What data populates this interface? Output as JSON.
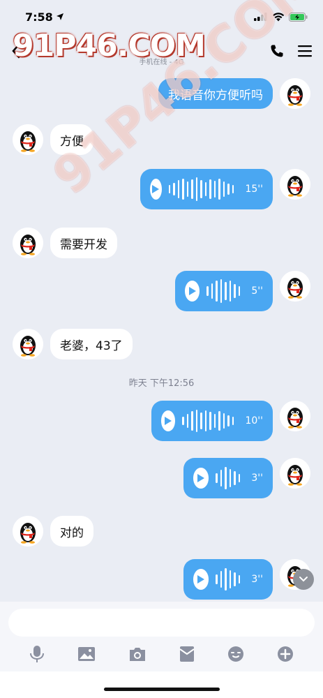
{
  "status_bar": {
    "time": "7:58"
  },
  "header": {
    "subtitle": "手机在线 - 4G"
  },
  "watermark": {
    "text": "91P46.COM"
  },
  "messages": [
    {
      "side": "out",
      "type": "text",
      "text": "我语音你方便听吗"
    },
    {
      "side": "in",
      "type": "text",
      "text": "方便"
    },
    {
      "side": "out",
      "type": "voice",
      "duration": "15''"
    },
    {
      "side": "in",
      "type": "text",
      "text": "需要开发"
    },
    {
      "side": "out",
      "type": "voice",
      "duration": "5''"
    },
    {
      "side": "in",
      "type": "text",
      "text": "老婆，43了"
    },
    {
      "side": "out",
      "type": "voice",
      "duration": "10''"
    },
    {
      "side": "out",
      "type": "voice",
      "duration": "3''"
    },
    {
      "side": "in",
      "type": "text",
      "text": "对的"
    },
    {
      "side": "out",
      "type": "voice",
      "duration": "3''"
    }
  ],
  "time_divider": "昨天 下午12:56",
  "input": {
    "placeholder": ""
  },
  "toolbar": [
    "mic-icon",
    "image-icon",
    "camera-icon",
    "red-packet-icon",
    "emoji-icon",
    "plus-icon"
  ],
  "colors": {
    "bubble_out": "#4aa7f2",
    "background": "#eaedf4"
  }
}
